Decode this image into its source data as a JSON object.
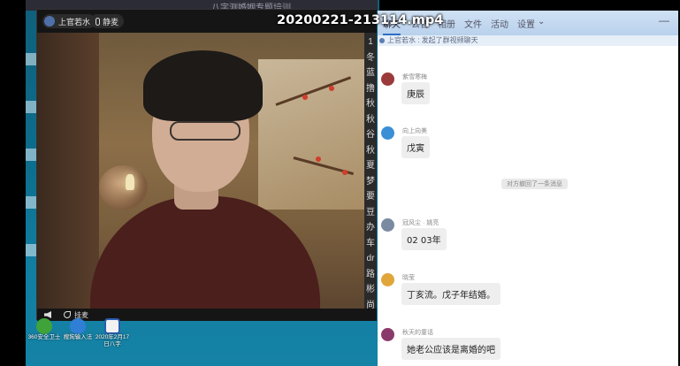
{
  "overlay": {
    "filename": "20200221-213114.mp4",
    "faded_title": "八字测婚姻专题培训"
  },
  "video": {
    "host_name": "上官若水",
    "mic_label": "静麦",
    "hangup_label": "挂麦",
    "side_chars": [
      "1",
      "冬",
      "蓝",
      "撸",
      "秋",
      "秋",
      "谷",
      "秋",
      "夏",
      "梦",
      "要",
      "豆",
      "办",
      "车",
      "dr",
      "路",
      "彬",
      "尚"
    ]
  },
  "desktop": {
    "icons": [
      {
        "name": "360安全卫士",
        "color": "#3fa33a"
      },
      {
        "name": "搜狗输入法",
        "color": "#2f7fd6"
      },
      {
        "name": "2020年2月17日八字",
        "color": "#2a5db0"
      }
    ]
  },
  "chat": {
    "tabs": [
      "聊天",
      "公告",
      "相册",
      "文件",
      "活动",
      "设置"
    ],
    "notice": "上官若水 : 发起了群视频聊天",
    "system_message": "对方撤回了一条消息",
    "messages": [
      {
        "sender": "紫雪寒梅",
        "text": "庚辰",
        "avatar_color": "#9b3a3a"
      },
      {
        "sender": "向上向美",
        "text": "戊寅",
        "avatar_color": "#3a8fd6"
      },
      {
        "sender": "冠风尘 · 姚亮",
        "text": "02 03年",
        "avatar_color": "#7a8aa0"
      },
      {
        "sender": "晓莹",
        "text": "丁亥流。戊子年结婚。",
        "avatar_color": "#e0a63a"
      },
      {
        "sender": "秋天的童话",
        "text": "她老公应该是离婚的吧",
        "avatar_color": "#8a3a6a"
      }
    ]
  }
}
